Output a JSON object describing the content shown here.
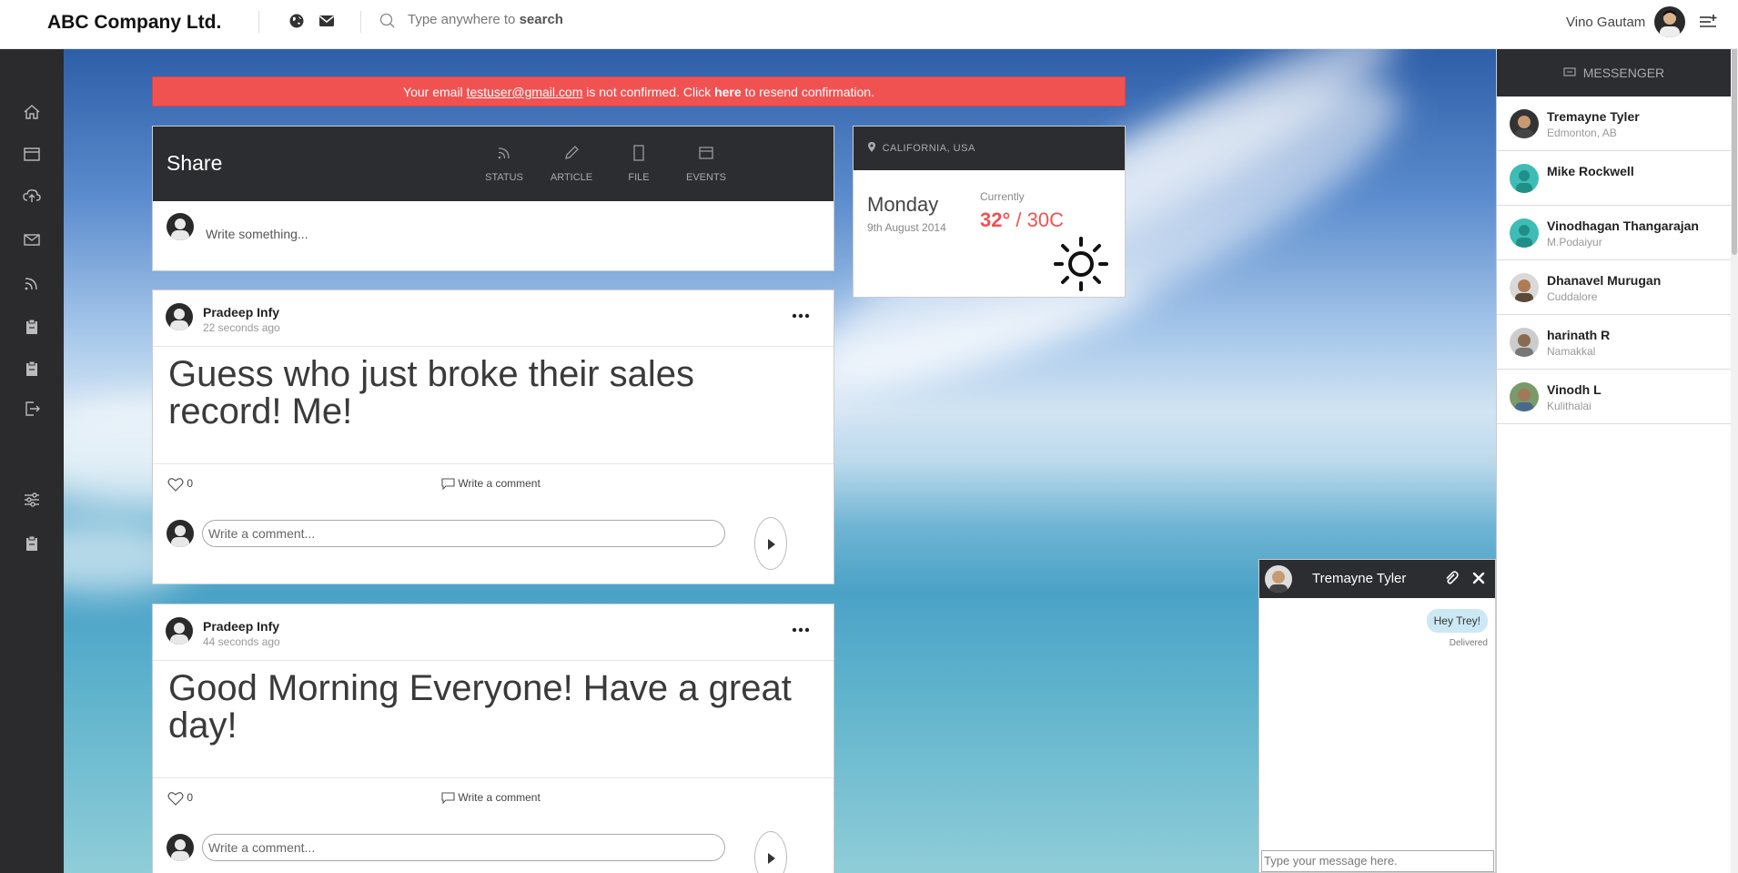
{
  "header": {
    "brand": "ABC Company Ltd.",
    "search_placeholder": "Type anywhere to",
    "search_keyword": "search",
    "user_name": "Vino Gautam"
  },
  "sidebar": {
    "items": [
      {
        "icon": "home-icon"
      },
      {
        "icon": "calendar-icon"
      },
      {
        "icon": "cloud-upload-icon"
      },
      {
        "icon": "mail-icon"
      },
      {
        "icon": "rss-icon"
      },
      {
        "icon": "clipboard-icon"
      },
      {
        "icon": "clipboard-icon"
      },
      {
        "icon": "logout-icon"
      },
      {
        "icon": "sliders-icon"
      },
      {
        "icon": "clipboard-icon"
      }
    ]
  },
  "alert": {
    "prefix": "Your email",
    "email": "testuser@gmail.com",
    "middle": "is not confirmed. Click",
    "link": "here",
    "suffix": "to resend confirmation."
  },
  "share": {
    "title": "Share",
    "tabs": [
      "STATUS",
      "ARTICLE",
      "FILE",
      "EVENTS"
    ],
    "placeholder": "Write something..."
  },
  "posts": [
    {
      "author": "Pradeep Infy",
      "time": "22 seconds ago",
      "text": "Guess who just broke their sales record! Me!",
      "likes": "0",
      "comment_label": "Write a comment",
      "comment_placeholder": "Write a comment..."
    },
    {
      "author": "Pradeep Infy",
      "time": "44 seconds ago",
      "text": "Good Morning Everyone! Have a great day!",
      "likes": "0",
      "comment_label": "Write a comment",
      "comment_placeholder": "Write a comment..."
    }
  ],
  "weather": {
    "location": "CALIFORNIA, USA",
    "day": "Monday",
    "date": "9th August 2014",
    "currently_label": "Currently",
    "temp_f": "32°",
    "temp_c": "/ 30C"
  },
  "messenger": {
    "title": "MESSENGER",
    "contacts": [
      {
        "name": "Tremayne Tyler",
        "location": "Edmonton, AB"
      },
      {
        "name": "Mike Rockwell",
        "location": ""
      },
      {
        "name": "Vinodhagan Thangarajan",
        "location": "M.Podaiyur"
      },
      {
        "name": "Dhanavel Murugan",
        "location": "Cuddalore"
      },
      {
        "name": "harinath R",
        "location": "Namakkal"
      },
      {
        "name": "Vinodh L",
        "location": "Kulithalai"
      }
    ]
  },
  "chat": {
    "name": "Tremayne Tyler",
    "message": "Hey Trey!",
    "status": "Delivered",
    "input_placeholder": "Type your message here."
  },
  "colors": {
    "accent_red": "#f05252",
    "dark_panel": "#2c2d31",
    "bubble": "#cbe8f4"
  }
}
